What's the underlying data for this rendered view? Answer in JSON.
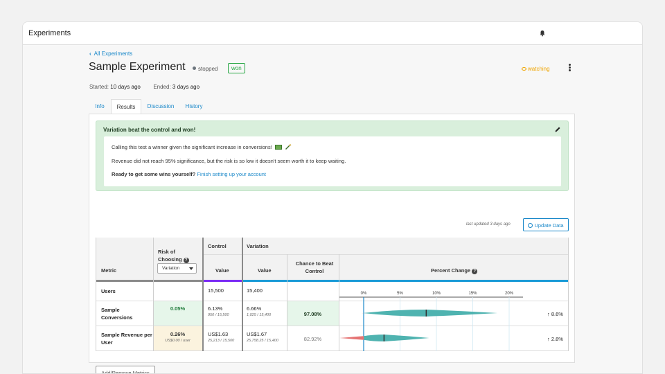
{
  "app": {
    "title": "Experiments"
  },
  "experiment": {
    "back_link": "All Experiments",
    "title": "Sample Experiment",
    "status": "stopped",
    "result_badge": "won",
    "watching_label": "watching",
    "started_label": "Started:",
    "started_value": "10 days ago",
    "ended_label": "Ended:",
    "ended_value": "3 days ago"
  },
  "tabs": [
    {
      "label": "Info",
      "active": false
    },
    {
      "label": "Results",
      "active": true
    },
    {
      "label": "Discussion",
      "active": false
    },
    {
      "label": "History",
      "active": false
    }
  ],
  "conclusion": {
    "title": "Variation beat the control and won!",
    "line1": "Calling this test a winner given the significant increase in conversions!",
    "line2": "Revenue did not reach 95% significance, but the risk is so low it doesn't seem worth it to keep waiting.",
    "line3_bold": "Ready to get some wins yourself?",
    "line3_link": "Finish setting up your account"
  },
  "updated": {
    "text": "last updated 3 days ago",
    "button": "Update Data"
  },
  "table": {
    "headers": {
      "metric": "Metric",
      "risk": "Risk of Choosing",
      "risk_select": "Variation",
      "control": "Control",
      "variation": "Variation",
      "value": "Value",
      "chance": "Chance to Beat Control",
      "percent_change": "Percent Change"
    },
    "axis_ticks": [
      "0%",
      "5%",
      "10%",
      "15%",
      "20%"
    ],
    "rows": [
      {
        "metric": "Users",
        "risk": "",
        "risk_sub": "",
        "control_value": "15,500",
        "control_sub": "",
        "variation_value": "15,400",
        "variation_sub": "",
        "chance": "",
        "change": ""
      },
      {
        "metric": "Sample Conversions",
        "risk": "0.05%",
        "risk_sub": "",
        "control_value": "6.13%",
        "control_sub": "950 / 15,500",
        "variation_value": "6.66%",
        "variation_sub": "1,025 / 15,400",
        "chance": "97.08%",
        "change": "8.6%"
      },
      {
        "metric": "Sample Revenue per User",
        "risk": "0.26%",
        "risk_sub": "US$0.00 / user",
        "control_value": "US$1.63",
        "control_sub": "25,213 / 15,500",
        "variation_value": "US$1.67",
        "variation_sub": "25,758.25 / 15,400",
        "chance": "82.92%",
        "change": "2.8%"
      }
    ]
  },
  "add_metrics_button": "Add/Remove Metrics",
  "colors": {
    "accent": "#1a88c9",
    "success": "#28a745",
    "control": "#7b2cf5",
    "variation": "#1a9bd7",
    "violin": "#4fb3b0",
    "violin_negative": "#e57373",
    "watching": "#f0a500"
  }
}
